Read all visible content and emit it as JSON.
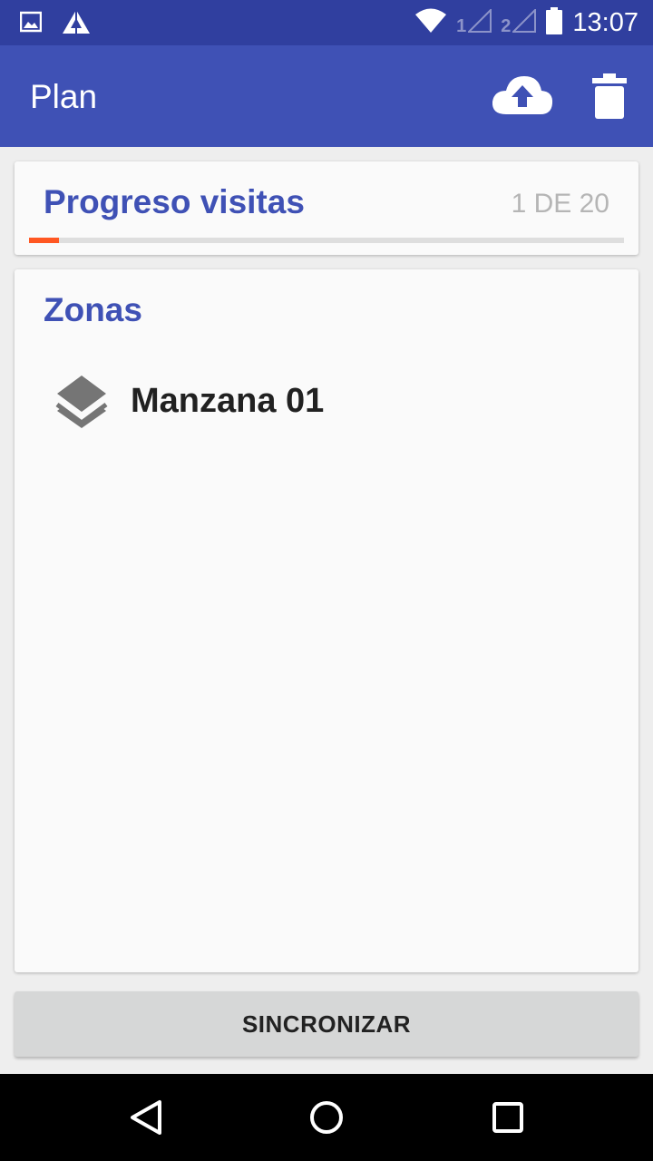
{
  "status_bar": {
    "time": "13:07",
    "sim1_label": "1",
    "sim2_label": "2",
    "icons": [
      "image-icon",
      "app-notification-icon",
      "wifi-icon",
      "signal-icon",
      "signal-icon",
      "battery-icon"
    ]
  },
  "app_bar": {
    "title": "Plan",
    "actions": [
      "cloud-upload-icon",
      "delete-icon"
    ]
  },
  "progress": {
    "title": "Progreso visitas",
    "count_text": "1 DE 20",
    "current": 1,
    "total": 20,
    "fraction": 0.05,
    "accent_color": "#ff5722"
  },
  "zonas": {
    "title": "Zonas",
    "items": [
      {
        "label": "Manzana 01",
        "icon": "layers-icon"
      }
    ]
  },
  "sync_button": {
    "label": "SINCRONIZAR"
  },
  "colors": {
    "primary": "#3f51b5",
    "primary_dark": "#303f9f",
    "accent": "#ff5722"
  }
}
